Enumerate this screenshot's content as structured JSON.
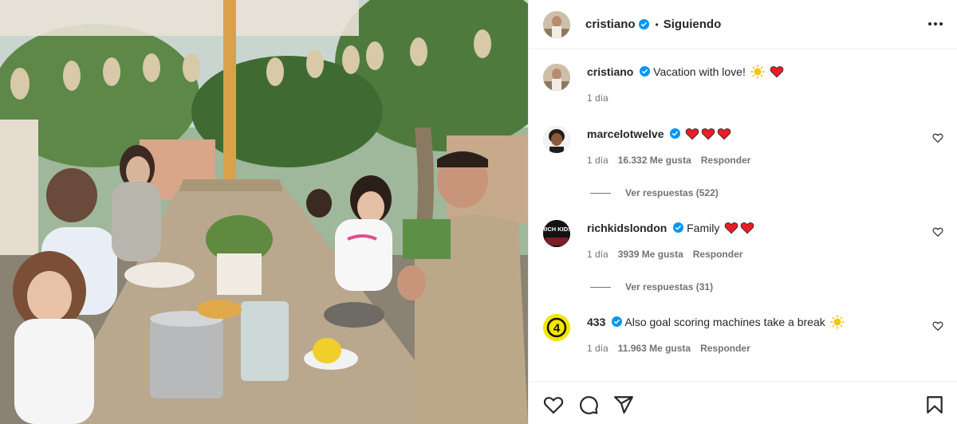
{
  "post": {
    "author": "cristiano",
    "follow_status": "Siguiendo",
    "more_icon": "more-options-icon"
  },
  "caption": {
    "username": "cristiano",
    "text": "Vacation with love!",
    "emojis": [
      "sun-emoji",
      "heart-emoji"
    ],
    "time": "1 día"
  },
  "comments": [
    {
      "username": "marcelotwelve",
      "verified": true,
      "text": "",
      "emojis": [
        "heart-emoji",
        "heart-emoji",
        "heart-emoji"
      ],
      "time": "1 día",
      "likes": "16.332 Me gusta",
      "reply": "Responder",
      "view_replies": "Ver respuestas (522)"
    },
    {
      "username": "richkidslondon",
      "verified": true,
      "text": "Family",
      "emojis": [
        "heart-emoji",
        "heart-emoji"
      ],
      "time": "1 día",
      "likes": "3939 Me gusta",
      "reply": "Responder",
      "view_replies": "Ver respuestas (31)"
    },
    {
      "username": "433",
      "verified": true,
      "text": "Also goal scoring machines take a break",
      "emojis": [
        "sun-emoji"
      ],
      "time": "1 día",
      "likes": "11.963 Me gusta",
      "reply": "Responder",
      "view_replies": ""
    }
  ],
  "avatars": {
    "richkids_text": "RICH KIDS",
    "badge_433": "4"
  },
  "colors": {
    "verified": "#0095f6",
    "heart": "#ed1c24",
    "sun": "#f5c518",
    "badge_433": "#f3e600",
    "meta_gray": "#737373"
  }
}
